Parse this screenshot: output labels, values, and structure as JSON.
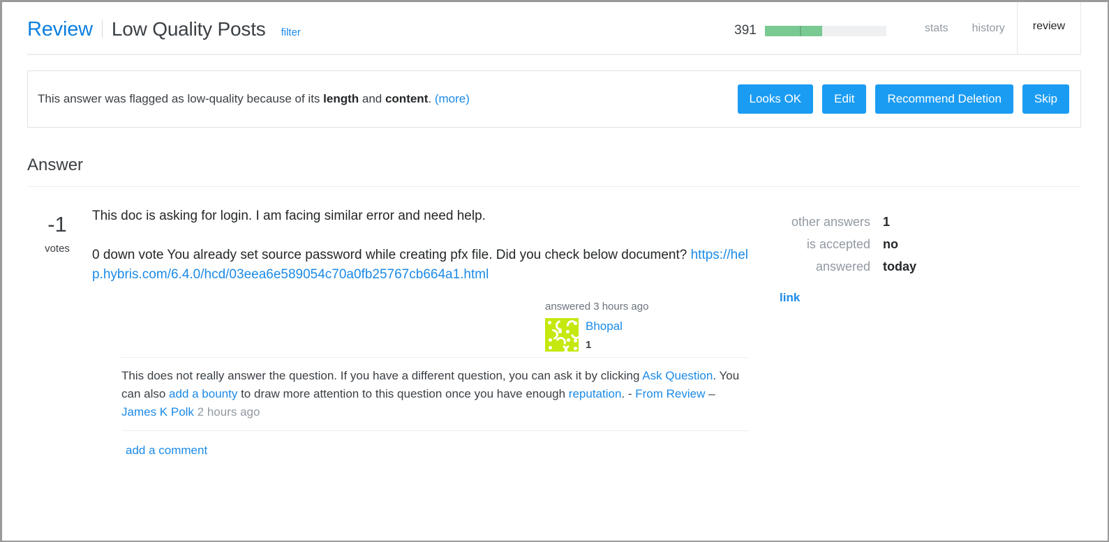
{
  "header": {
    "brand": "Review",
    "queue_title": "Low Quality Posts",
    "filter_label": "filter",
    "progress": {
      "count": "391",
      "fill_percent": 47,
      "divider_percent": 29,
      "fill_color": "#79c992",
      "track_color": "#eff0f1"
    },
    "tabs": [
      {
        "label": "stats",
        "active": false
      },
      {
        "label": "history",
        "active": false
      },
      {
        "label": "review",
        "active": true
      }
    ],
    "active_tab_accent": "#f48024"
  },
  "notice": {
    "text_before": "This answer was flagged as low-quality because of its ",
    "reason_one": "length",
    "text_middle": " and ",
    "reason_two": "content",
    "text_after": ".",
    "more_label": "(more)",
    "actions": [
      {
        "label": "Looks OK"
      },
      {
        "label": "Edit"
      },
      {
        "label": "Recommend Deletion"
      },
      {
        "label": "Skip"
      }
    ],
    "button_color": "#1b9cf3"
  },
  "answer": {
    "section_heading": "Answer",
    "votes": {
      "count": "-1",
      "label": "votes"
    },
    "paragraph_1": "This doc is asking for login. I am facing similar error and need help.",
    "paragraph_2_before_link": "0 down vote You already set source password while creating pfx file. Did you check below document? ",
    "paragraph_2_link": "https://help.hybris.com/6.4.0/hcd/03eea6e589054c70a0fb25767cb664a1.html",
    "signature": {
      "answered_label": "answered 3 hours ago",
      "user_name": "Bhopal",
      "user_reputation": "1",
      "avatar_color": "#c5e80f"
    },
    "comments": [
      {
        "segments": [
          {
            "type": "text",
            "value": "This does not really answer the question. If you have a different question, you can ask it by clicking "
          },
          {
            "type": "link",
            "value": "Ask Question"
          },
          {
            "type": "text",
            "value": ". You can also "
          },
          {
            "type": "link",
            "value": "add a bounty"
          },
          {
            "type": "text",
            "value": " to draw more attention to this question once you have enough "
          },
          {
            "type": "link",
            "value": "reputation"
          },
          {
            "type": "text",
            "value": ". - "
          },
          {
            "type": "link",
            "value": "From Review"
          },
          {
            "type": "dash",
            "value": " – "
          },
          {
            "type": "user",
            "value": "James K Polk"
          },
          {
            "type": "time",
            "value": " 2 hours ago"
          }
        ]
      }
    ],
    "add_comment_label": "add a comment"
  },
  "stats_panel": {
    "rows": [
      {
        "label": "other answers",
        "value": "1"
      },
      {
        "label": "is accepted",
        "value": "no"
      },
      {
        "label": "answered",
        "value": "today"
      }
    ],
    "link_label": "link"
  }
}
